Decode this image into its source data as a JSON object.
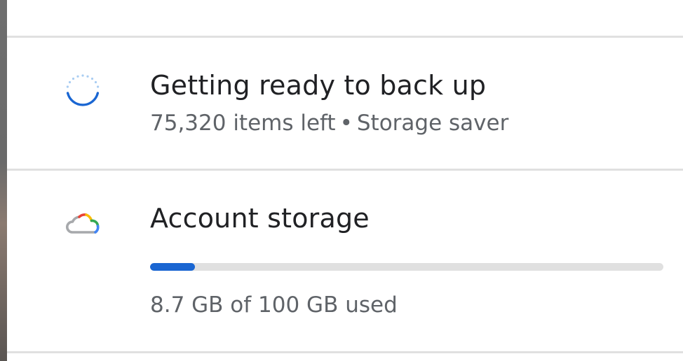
{
  "backup": {
    "title": "Getting ready to back up",
    "items_left": "75,320 items left",
    "separator": "•",
    "quality": "Storage saver",
    "icon": "loading-spinner-icon"
  },
  "storage": {
    "title": "Account storage",
    "usage_text": "8.7 GB of 100 GB used",
    "used_fraction": 0.087,
    "icon": "cloud-icon"
  },
  "colors": {
    "accent_blue": "#1a66d2",
    "track_gray": "#e0e0e0",
    "title_text": "#202124",
    "secondary_text": "#5f6368"
  }
}
